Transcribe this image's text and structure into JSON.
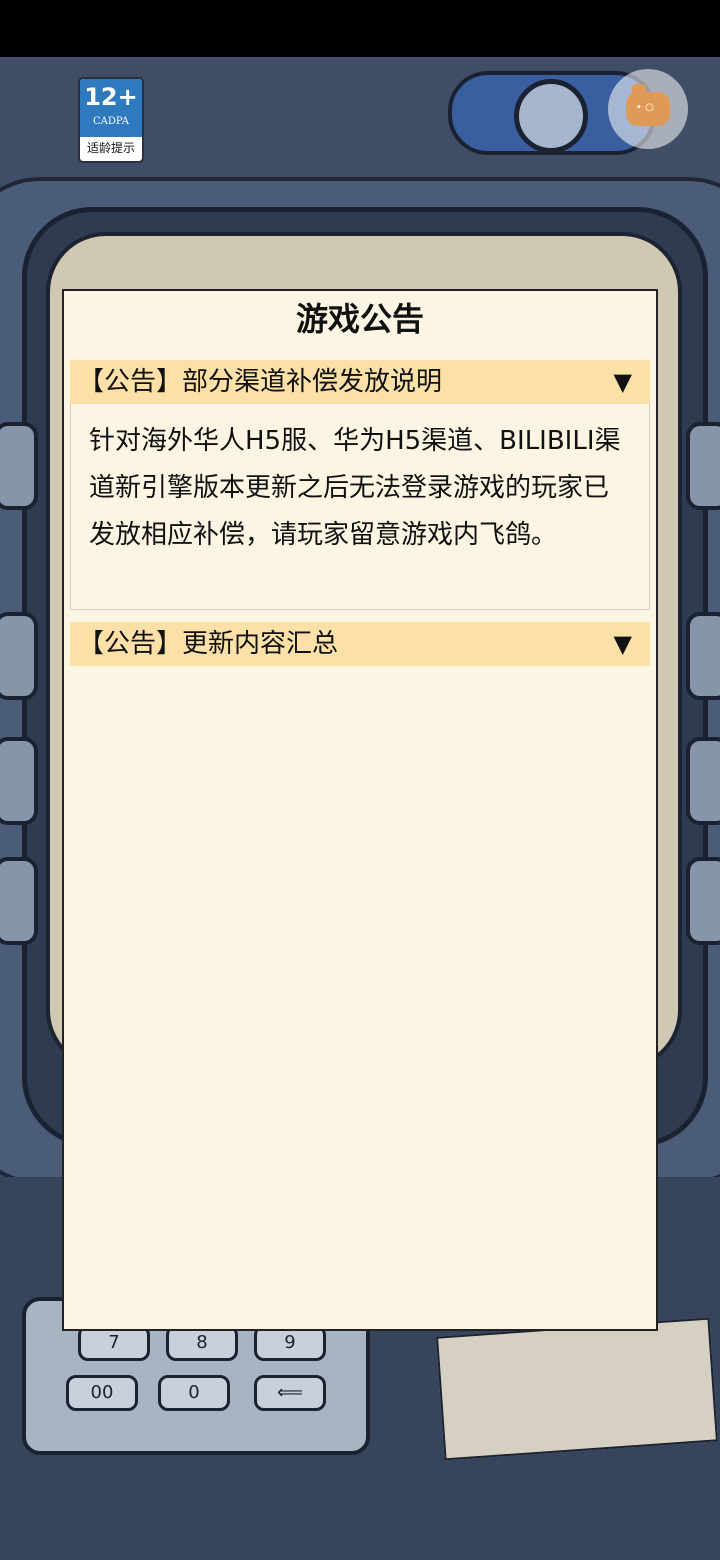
{
  "age_badge": {
    "rating": "12+",
    "org": "CADPA",
    "label": "适龄提示"
  },
  "dialog": {
    "title": "游戏公告",
    "notices": [
      {
        "title": "【公告】部分渠道补偿发放说明",
        "arrow": "▼",
        "expanded": true,
        "body": "针对海外华人H5服、华为H5渠道、BILIBILI渠道新引擎版本更新之后无法登录游戏的玩家已发放相应补偿，请玩家留意游戏内飞鸽。"
      },
      {
        "title": "【公告】更新内容汇总",
        "arrow": "▼",
        "expanded": false
      }
    ]
  },
  "keypad": {
    "keys": [
      "7",
      "8",
      "9",
      "00",
      "0",
      "⟸"
    ]
  },
  "colors": {
    "notice_header_bg": "#fbe0a8",
    "dialog_bg": "#fdf5e3",
    "badge_blue": "#2f79be"
  }
}
